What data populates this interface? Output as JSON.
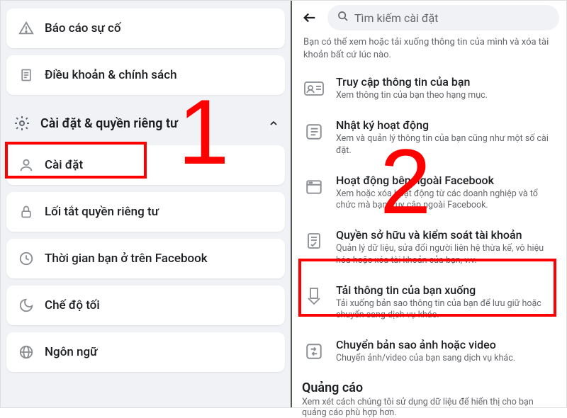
{
  "left": {
    "items": {
      "report": "Báo cáo sự cố",
      "terms": "Điều khoản & chính sách"
    },
    "section_title": "Cài đặt & quyền riêng tư",
    "sub": {
      "settings": "Cài đặt",
      "privacy_shortcut": "Lối tắt quyền riêng tư",
      "time_on_fb": "Thời gian bạn ở trên Facebook",
      "dark_mode": "Chế độ tối",
      "language": "Ngôn ngữ"
    }
  },
  "right": {
    "search_placeholder": "Tìm kiếm cài đặt",
    "intro": "Bạn có thể xem hoặc tải xuống thông tin của mình và xóa tài khoản bất cứ lúc nào.",
    "opts": [
      {
        "title": "Truy cập thông tin của bạn",
        "desc": "Xem thông tin của bạn theo hạng mục."
      },
      {
        "title": "Nhật ký hoạt động",
        "desc": "Xem và quản lý thông tin của bạn cũng như một số cài đặt."
      },
      {
        "title": "Hoạt động bên ngoài Facebook",
        "desc": "Xem hoặc xóa hoạt động từ các doanh nghiệp và tổ chức mà bạn truy cập ngoài Facebook."
      },
      {
        "title": "Quyền sở hữu và kiểm soát tài khoản",
        "desc": "Quản lý dữ liệu, sửa đổi người liên hệ thừa kế, vô hiệu hóa hoặc xóa tài khoản của bạn, v.v."
      },
      {
        "title": "Tải thông tin của bạn xuống",
        "desc": "Tải xuống bản sao thông tin của bạn để lưu giữ hoặc chuyển sang dịch vụ khác."
      },
      {
        "title": "Chuyển bản sao ảnh hoặc video",
        "desc": "Chuyển ảnh/video của bạn sang dịch vụ khác."
      }
    ],
    "ads_title": "Quảng cáo",
    "ads_desc": "Xem xét cách chúng tôi sử dụng dữ liệu để hiển thị cho bạn quảng cáo phù hợp hơn."
  },
  "annotations": {
    "num1": "1",
    "num2": "2"
  }
}
